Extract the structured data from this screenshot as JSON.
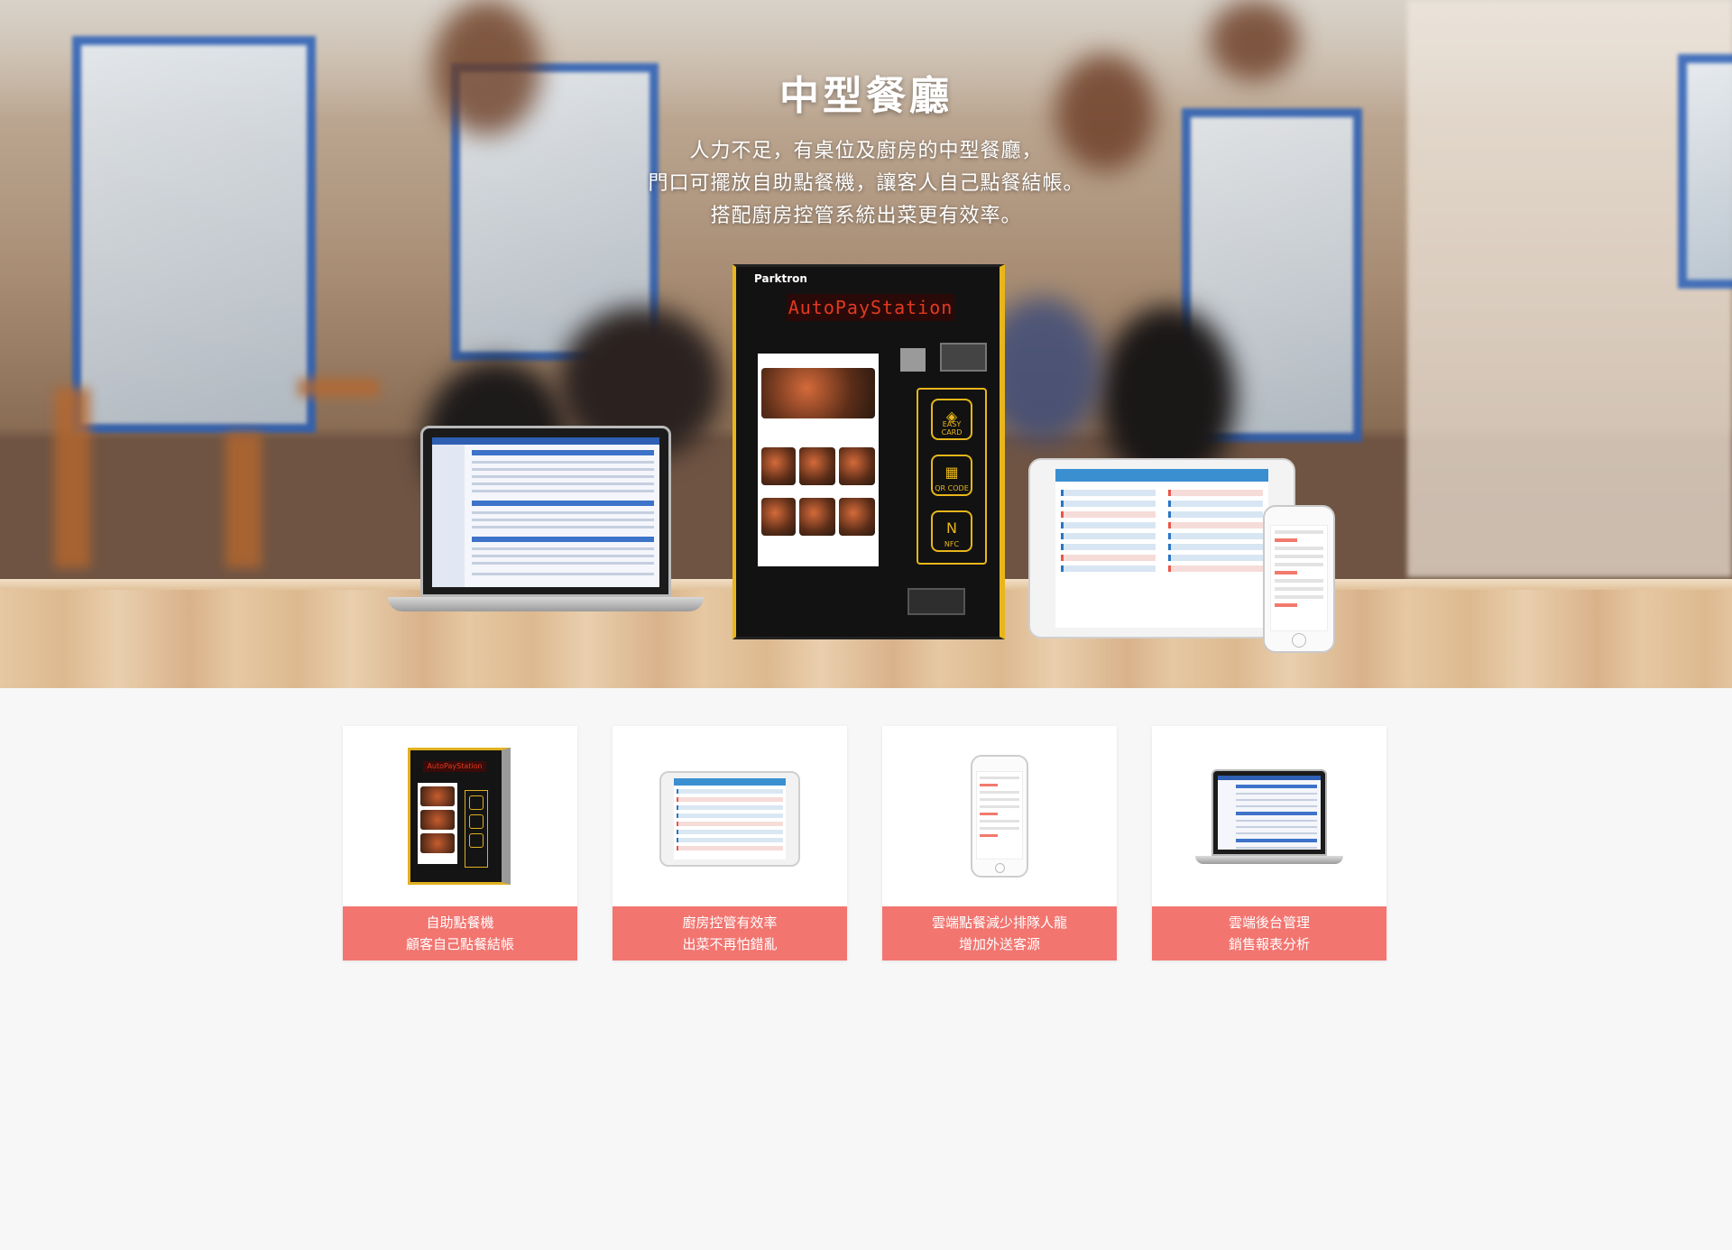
{
  "hero": {
    "title": "中型餐廳",
    "description": [
      "人力不足，有桌位及廚房的中型餐廳，",
      "門口可擺放自助點餐機，讓客人自己點餐結帳。",
      "搭配廚房控管系統出菜更有效率。"
    ],
    "kiosk": {
      "brand": "Parktron",
      "display": "AutoPayStation",
      "buttons": [
        "EASY CARD",
        "QR CODE",
        "NFC"
      ]
    }
  },
  "cards": [
    {
      "line1": "自助點餐機",
      "line2": "顧客自己點餐結帳",
      "image": "kiosk-image"
    },
    {
      "line1": "廚房控管有效率",
      "line2": "出菜不再怕錯亂",
      "image": "tablet-image"
    },
    {
      "line1": "雲端點餐減少排隊人龍",
      "line2": "增加外送客源",
      "image": "phone-image"
    },
    {
      "line1": "雲端後台管理",
      "line2": "銷售報表分析",
      "image": "laptop-image"
    }
  ],
  "colors": {
    "caption_bg": "#f27570",
    "kiosk_accent": "#e8b61a",
    "page_bg": "#f7f7f7"
  }
}
